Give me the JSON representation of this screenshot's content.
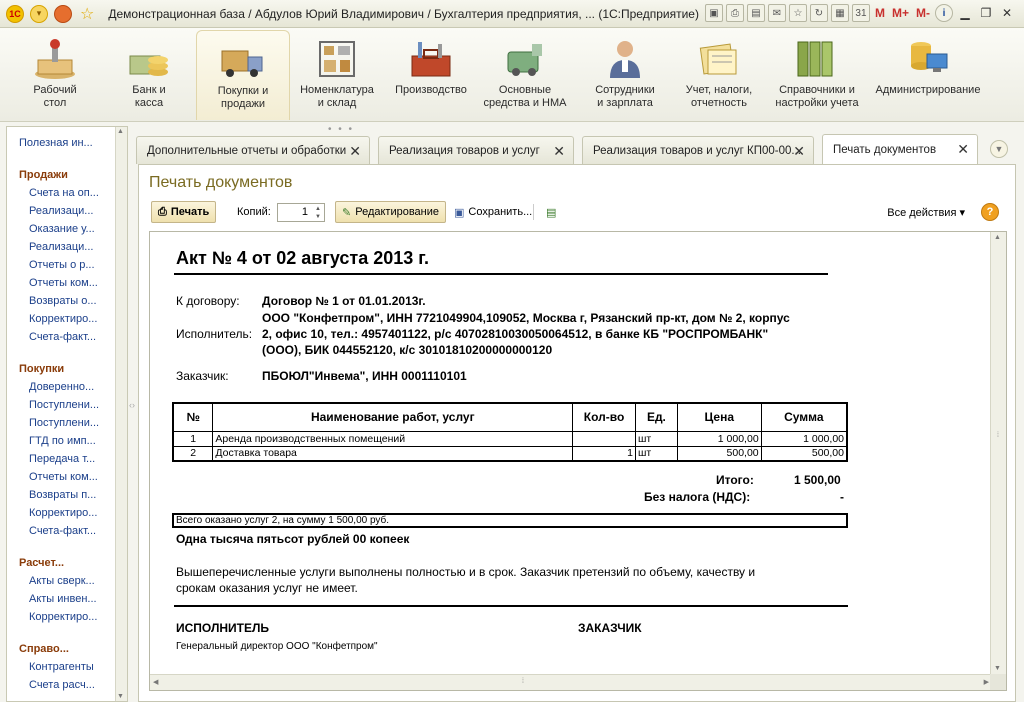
{
  "window": {
    "title": "Демонстрационная база / Абдулов Юрий Владимирович / Бухгалтерия предприятия, ...   (1С:Предприятие)",
    "toolbar_m": [
      "M",
      "M+",
      "M-"
    ]
  },
  "sections": [
    {
      "label": "Рабочий\nстол",
      "icon": "desktop-icon"
    },
    {
      "label": "Банк и\nкасса",
      "icon": "money-icon"
    },
    {
      "label": "Покупки и\nпродажи",
      "icon": "truck-icon"
    },
    {
      "label": "Номенклатура\nи склад",
      "icon": "warehouse-icon"
    },
    {
      "label": "Производство",
      "icon": "tools-icon"
    },
    {
      "label": "Основные\nсредства и НМА",
      "icon": "assets-icon"
    },
    {
      "label": "Сотрудники\nи зарплата",
      "icon": "employee-icon"
    },
    {
      "label": "Учет, налоги,\nотчетность",
      "icon": "reports-icon"
    },
    {
      "label": "Справочники и\nнастройки учета",
      "icon": "binders-icon"
    },
    {
      "label": "Администрирование",
      "icon": "admin-icon"
    }
  ],
  "nav": {
    "top_item": "Полезная ин...",
    "groups": [
      {
        "title": "Продажи",
        "items": [
          "Счета на оп...",
          "Реализаци...",
          "Оказание у...",
          "Реализаци...",
          "Отчеты о р...",
          "Отчеты ком...",
          "Возвраты о...",
          "Корректиро...",
          "Счета-факт..."
        ]
      },
      {
        "title": "Покупки",
        "items": [
          "Доверенно...",
          "Поступлени...",
          "Поступлени...",
          "ГТД по имп...",
          "Передача т...",
          "Отчеты ком...",
          "Возвраты п...",
          "Корректиро...",
          "Счета-факт..."
        ]
      },
      {
        "title": "Расчет...",
        "items": [
          "Акты сверк...",
          "Акты инвен...",
          "Корректиро..."
        ]
      },
      {
        "title": "Справо...",
        "items": [
          "Контрагенты",
          "Счета расч..."
        ]
      }
    ]
  },
  "tabs": [
    {
      "label": "Дополнительные отчеты и обработки"
    },
    {
      "label": "Реализация товаров и услуг"
    },
    {
      "label": "Реализация товаров и услуг КП00-00..."
    },
    {
      "label": "Печать документов"
    }
  ],
  "form": {
    "title": "Печать документов",
    "print_label": "Печать",
    "copies_label": "Копий:",
    "copies_value": "1",
    "edit_label": "Редактирование",
    "save_label": "Сохранить...",
    "all_actions_label": "Все действия ▾",
    "help_label": "?"
  },
  "document": {
    "title": "Акт № 4 от 02 августа 2013 г.",
    "contract_label": "К договору:",
    "contract_value": "Договор № 1 от 01.01.2013г.",
    "executor_label": "Исполнитель:",
    "executor_lines": [
      "ООО \"Конфетпром\", ИНН 7721049904,109052, Москва г, Рязанский пр-кт, дом № 2, корпус",
      "2, офис 10, тел.: 4957401122, р/с 40702810030050064512, в банке КБ \"РОСПРОМБАНК\"",
      "(ООО), БИК 044552120, к/с 30101810200000000120"
    ],
    "customer_label": "Заказчик:",
    "customer_value": "ПБОЮЛ\"Инвема\", ИНН 0001110101",
    "table_headers": [
      "№",
      "Наименование работ, услуг",
      "Кол-во",
      "Ед.",
      "Цена",
      "Сумма"
    ],
    "rows": [
      {
        "n": "1",
        "name": "Аренда производственных помещений",
        "qty": "",
        "unit": "шт",
        "price": "1 000,00",
        "sum": "1 000,00"
      },
      {
        "n": "2",
        "name": "Доставка товара",
        "qty": "1",
        "unit": "шт",
        "price": "500,00",
        "sum": "500,00"
      }
    ],
    "total_label": "Итого:",
    "total_value": "1 500,00",
    "vat_label": "Без налога (НДС):",
    "vat_value": "-",
    "summary": "Всего оказано услуг 2, на сумму 1 500,00 руб.",
    "sum_words": "Одна тысяча пятьсот рублей 00 копеек",
    "statement_lines": [
      "Вышеперечисленные услуги выполнены полностью и в срок. Заказчик претензий по объему, качеству и",
      "срокам оказания услуг не имеет."
    ],
    "executor_sign": "ИСПОЛНИТЕЛЬ",
    "customer_sign": "ЗАКАЗЧИК",
    "executor_position": "Генеральный директор ООО \"Конфетпром\""
  }
}
